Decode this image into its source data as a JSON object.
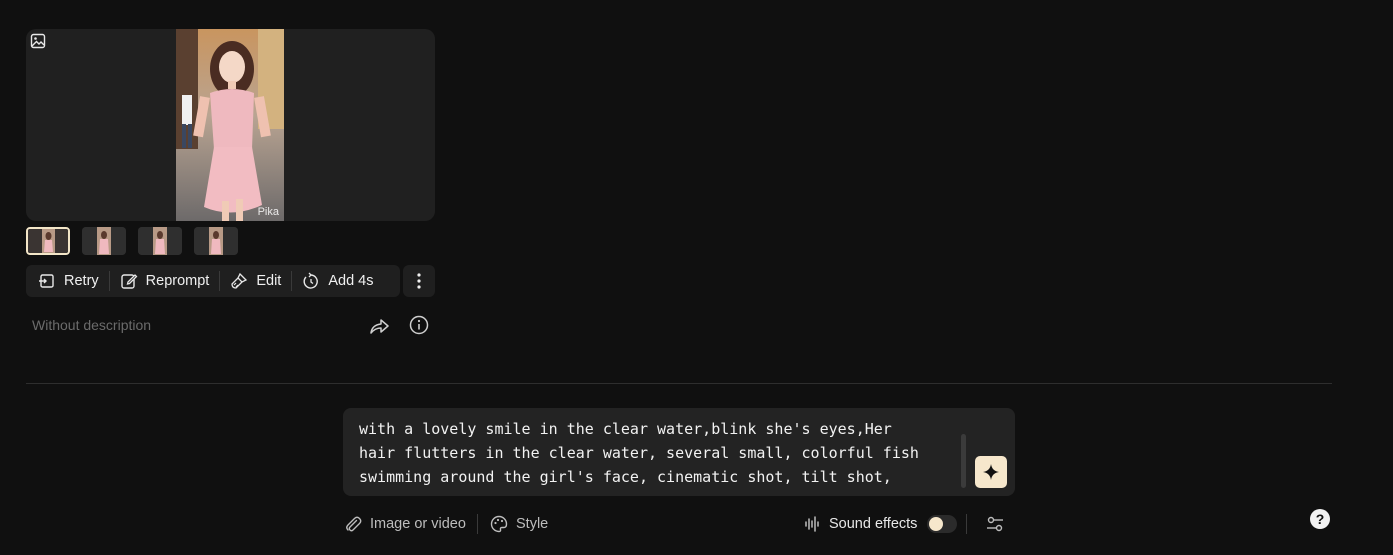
{
  "result": {
    "watermark": "Pika",
    "thumbnails": [
      {
        "selected": true
      },
      {
        "selected": false
      },
      {
        "selected": false
      },
      {
        "selected": false
      }
    ],
    "actions": {
      "retry": "Retry",
      "reprompt": "Reprompt",
      "edit": "Edit",
      "add": "Add 4s"
    },
    "description": "Without description"
  },
  "composer": {
    "prompt": "with a lovely smile in the clear water,blink she's eyes,Her\nhair flutters in the clear water, several small, colorful fish\nswimming around the girl's face, cinematic shot, tilt shot,",
    "image_or_video": "Image or video",
    "style": "Style",
    "sound_effects": "Sound effects",
    "sound_effects_on": false
  },
  "colors": {
    "background": "#101010",
    "accent": "#f6e7cc"
  },
  "icons": [
    "image-icon",
    "retry-icon",
    "reprompt-icon",
    "edit-brush-icon",
    "add-time-icon",
    "more-vertical-icon",
    "share-icon",
    "info-icon",
    "sparkle-icon",
    "paperclip-icon",
    "palette-icon",
    "sound-wave-icon",
    "settings-sliders-icon",
    "help-icon"
  ]
}
